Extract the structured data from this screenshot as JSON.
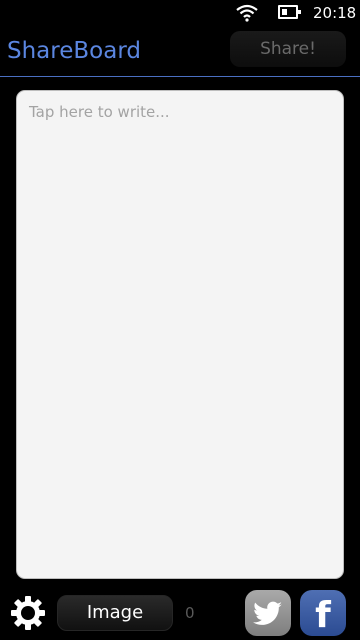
{
  "status_bar": {
    "time": "20:18",
    "wifi_icon": "wifi-icon",
    "battery_icon": "battery-icon"
  },
  "header": {
    "title": "ShareBoard",
    "share_label": "Share!"
  },
  "editor": {
    "placeholder": "Tap here to write..."
  },
  "toolbar": {
    "settings_icon": "gear-icon",
    "image_label": "Image",
    "count": "0",
    "twitter_icon": "twitter-icon",
    "facebook_icon": "facebook-icon",
    "facebook_glyph": "f"
  },
  "colors": {
    "accent": "#5b86e0",
    "background": "#000000",
    "editor_background": "#f4f4f4",
    "twitter": "#999999",
    "facebook": "#3b5998"
  }
}
